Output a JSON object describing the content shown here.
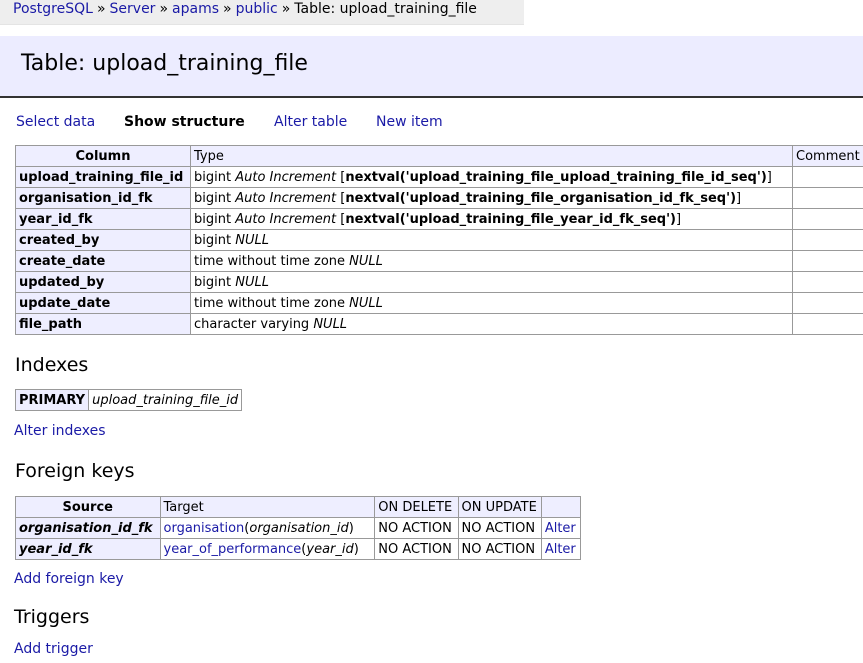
{
  "breadcrumb": {
    "items": [
      "PostgreSQL",
      "Server",
      "apams",
      "public"
    ],
    "separator": "»",
    "current": "Table: upload_training_file"
  },
  "page_title": "Table: upload_training_file",
  "menu": {
    "select": "Select data",
    "structure": "Show structure",
    "alter": "Alter table",
    "new_item": "New item"
  },
  "structure": {
    "headers": [
      "Column",
      "Type",
      "Comment"
    ],
    "rows": [
      {
        "name": "upload_training_file_id",
        "type": "bigint",
        "attr": "Auto Increment",
        "default": "nextval('upload_training_file_upload_training_file_id_seq')"
      },
      {
        "name": "organisation_id_fk",
        "type": "bigint",
        "attr": "Auto Increment",
        "default": "nextval('upload_training_file_organisation_id_fk_seq')"
      },
      {
        "name": "year_id_fk",
        "type": "bigint",
        "attr": "Auto Increment",
        "default": "nextval('upload_training_file_year_id_fk_seq')"
      },
      {
        "name": "created_by",
        "type": "bigint",
        "attr": "NULL",
        "default": ""
      },
      {
        "name": "create_date",
        "type": "time without time zone",
        "attr": "NULL",
        "default": ""
      },
      {
        "name": "updated_by",
        "type": "bigint",
        "attr": "NULL",
        "default": ""
      },
      {
        "name": "update_date",
        "type": "time without time zone",
        "attr": "NULL",
        "default": ""
      },
      {
        "name": "file_path",
        "type": "character varying",
        "attr": "NULL",
        "default": ""
      }
    ]
  },
  "indexes": {
    "heading": "Indexes",
    "rows": [
      {
        "type": "PRIMARY",
        "columns": "upload_training_file_id"
      }
    ],
    "alter_link": "Alter indexes"
  },
  "foreign_keys": {
    "heading": "Foreign keys",
    "headers": [
      "Source",
      "Target",
      "ON DELETE",
      "ON UPDATE",
      ""
    ],
    "rows": [
      {
        "source": "organisation_id_fk",
        "target_table": "organisation",
        "target_col": "organisation_id",
        "on_delete": "NO ACTION",
        "on_update": "NO ACTION",
        "action": "Alter"
      },
      {
        "source": "year_id_fk",
        "target_table": "year_of_performance",
        "target_col": "year_id",
        "on_delete": "NO ACTION",
        "on_update": "NO ACTION",
        "action": "Alter"
      }
    ],
    "add_link": "Add foreign key"
  },
  "triggers": {
    "heading": "Triggers",
    "add_link": "Add trigger"
  }
}
